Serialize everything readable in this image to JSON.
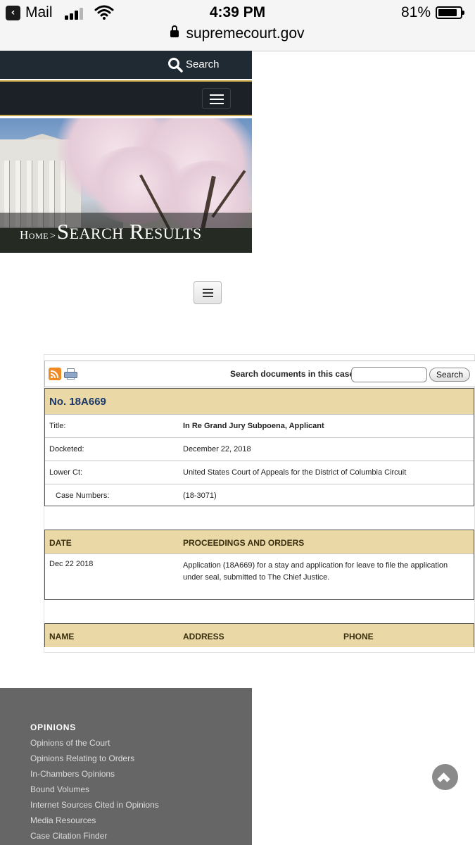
{
  "status_bar": {
    "back_app": "Mail",
    "time": "4:39 PM",
    "battery": "81%",
    "battery_level": 0.81,
    "url": "supremecourt.gov"
  },
  "header": {
    "search_label": "Search"
  },
  "hero": {
    "breadcrumb_home": "Home",
    "breadcrumb_sep": ">",
    "page_title": "Search Results"
  },
  "docket": {
    "search_prompt": "Search documents in this case:",
    "search_value": "",
    "search_button": "Search",
    "case_number": "No. 18A669",
    "fields": [
      {
        "label": "Title:",
        "value": "In Re Grand Jury Subpoena, Applicant"
      },
      {
        "label": "Docketed:",
        "value": "December 22, 2018"
      },
      {
        "label": "Lower Ct:",
        "value": "United States Court of Appeals for the District of Columbia Circuit"
      },
      {
        "label": "Case Numbers:",
        "value": "(18-3071)"
      }
    ],
    "proceedings_headers": [
      "DATE",
      "PROCEEDINGS AND ORDERS"
    ],
    "proceedings": [
      {
        "date": "Dec 22 2018",
        "text": "Application (18A669) for a stay and application for leave to file the application under seal, submitted to The Chief Justice."
      }
    ],
    "contact_headers": [
      "NAME",
      "ADDRESS",
      "PHONE"
    ]
  },
  "footer": {
    "heading": "OPINIONS",
    "links": [
      "Opinions of the Court",
      "Opinions Relating to Orders",
      "In-Chambers Opinions",
      "Bound Volumes",
      "Internet Sources Cited in Opinions",
      "Media Resources",
      "Case Citation Finder"
    ]
  },
  "colors": {
    "header_dark": "#1f2a33",
    "nav_gold": "#c9a94a",
    "band_tan": "#ead9a6",
    "case_blue": "#1b3a6b",
    "footer_gray": "#666666"
  },
  "icons": [
    "back-arrow-icon",
    "signal-icon",
    "wifi-icon",
    "battery-icon",
    "lock-icon",
    "search-icon",
    "hamburger-icon",
    "rss-icon",
    "printer-icon",
    "back-to-top-icon"
  ]
}
